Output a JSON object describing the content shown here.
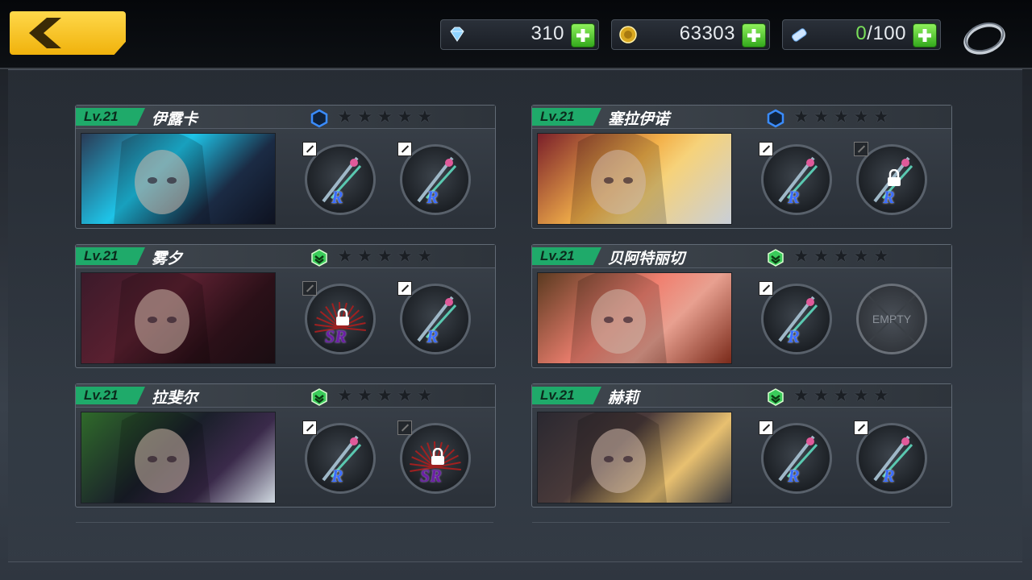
{
  "resources": {
    "diamonds": "310",
    "gold": "63303",
    "stamina_current": "0",
    "stamina_max": "/100"
  },
  "slot_labels": {
    "empty": "EMPTY"
  },
  "characters": [
    {
      "level": "Lv.21",
      "name": "伊露卡",
      "rank_color": "#3a8cff",
      "weapons": [
        {
          "rarity": "R",
          "locked": false
        },
        {
          "rarity": "R",
          "locked": false
        }
      ]
    },
    {
      "level": "Lv.21",
      "name": "塞拉伊诺",
      "rank_color": "#3a8cff",
      "weapons": [
        {
          "rarity": "R",
          "locked": false
        },
        {
          "rarity": "R",
          "locked": true
        }
      ]
    },
    {
      "level": "Lv.21",
      "name": "雾夕",
      "rank_color": "#3acb5a",
      "weapons": [
        {
          "rarity": "SR",
          "locked": true
        },
        {
          "rarity": "R",
          "locked": false
        }
      ]
    },
    {
      "level": "Lv.21",
      "name": "贝阿特丽切",
      "rank_color": "#3acb5a",
      "weapons": [
        {
          "rarity": "R",
          "locked": false
        },
        {
          "rarity": "EMPTY",
          "locked": false
        }
      ]
    },
    {
      "level": "Lv.21",
      "name": "拉斐尔",
      "rank_color": "#3acb5a",
      "weapons": [
        {
          "rarity": "R",
          "locked": false
        },
        {
          "rarity": "SR",
          "locked": true
        }
      ]
    },
    {
      "level": "Lv.21",
      "name": "赫莉",
      "rank_color": "#3acb5a",
      "weapons": [
        {
          "rarity": "R",
          "locked": false
        },
        {
          "rarity": "R",
          "locked": false
        }
      ]
    }
  ],
  "stars_per_card": 5,
  "colors": {
    "back_button": "#f5c21a",
    "level_tag": "#1faa6a",
    "plus": "#5ad13a"
  }
}
